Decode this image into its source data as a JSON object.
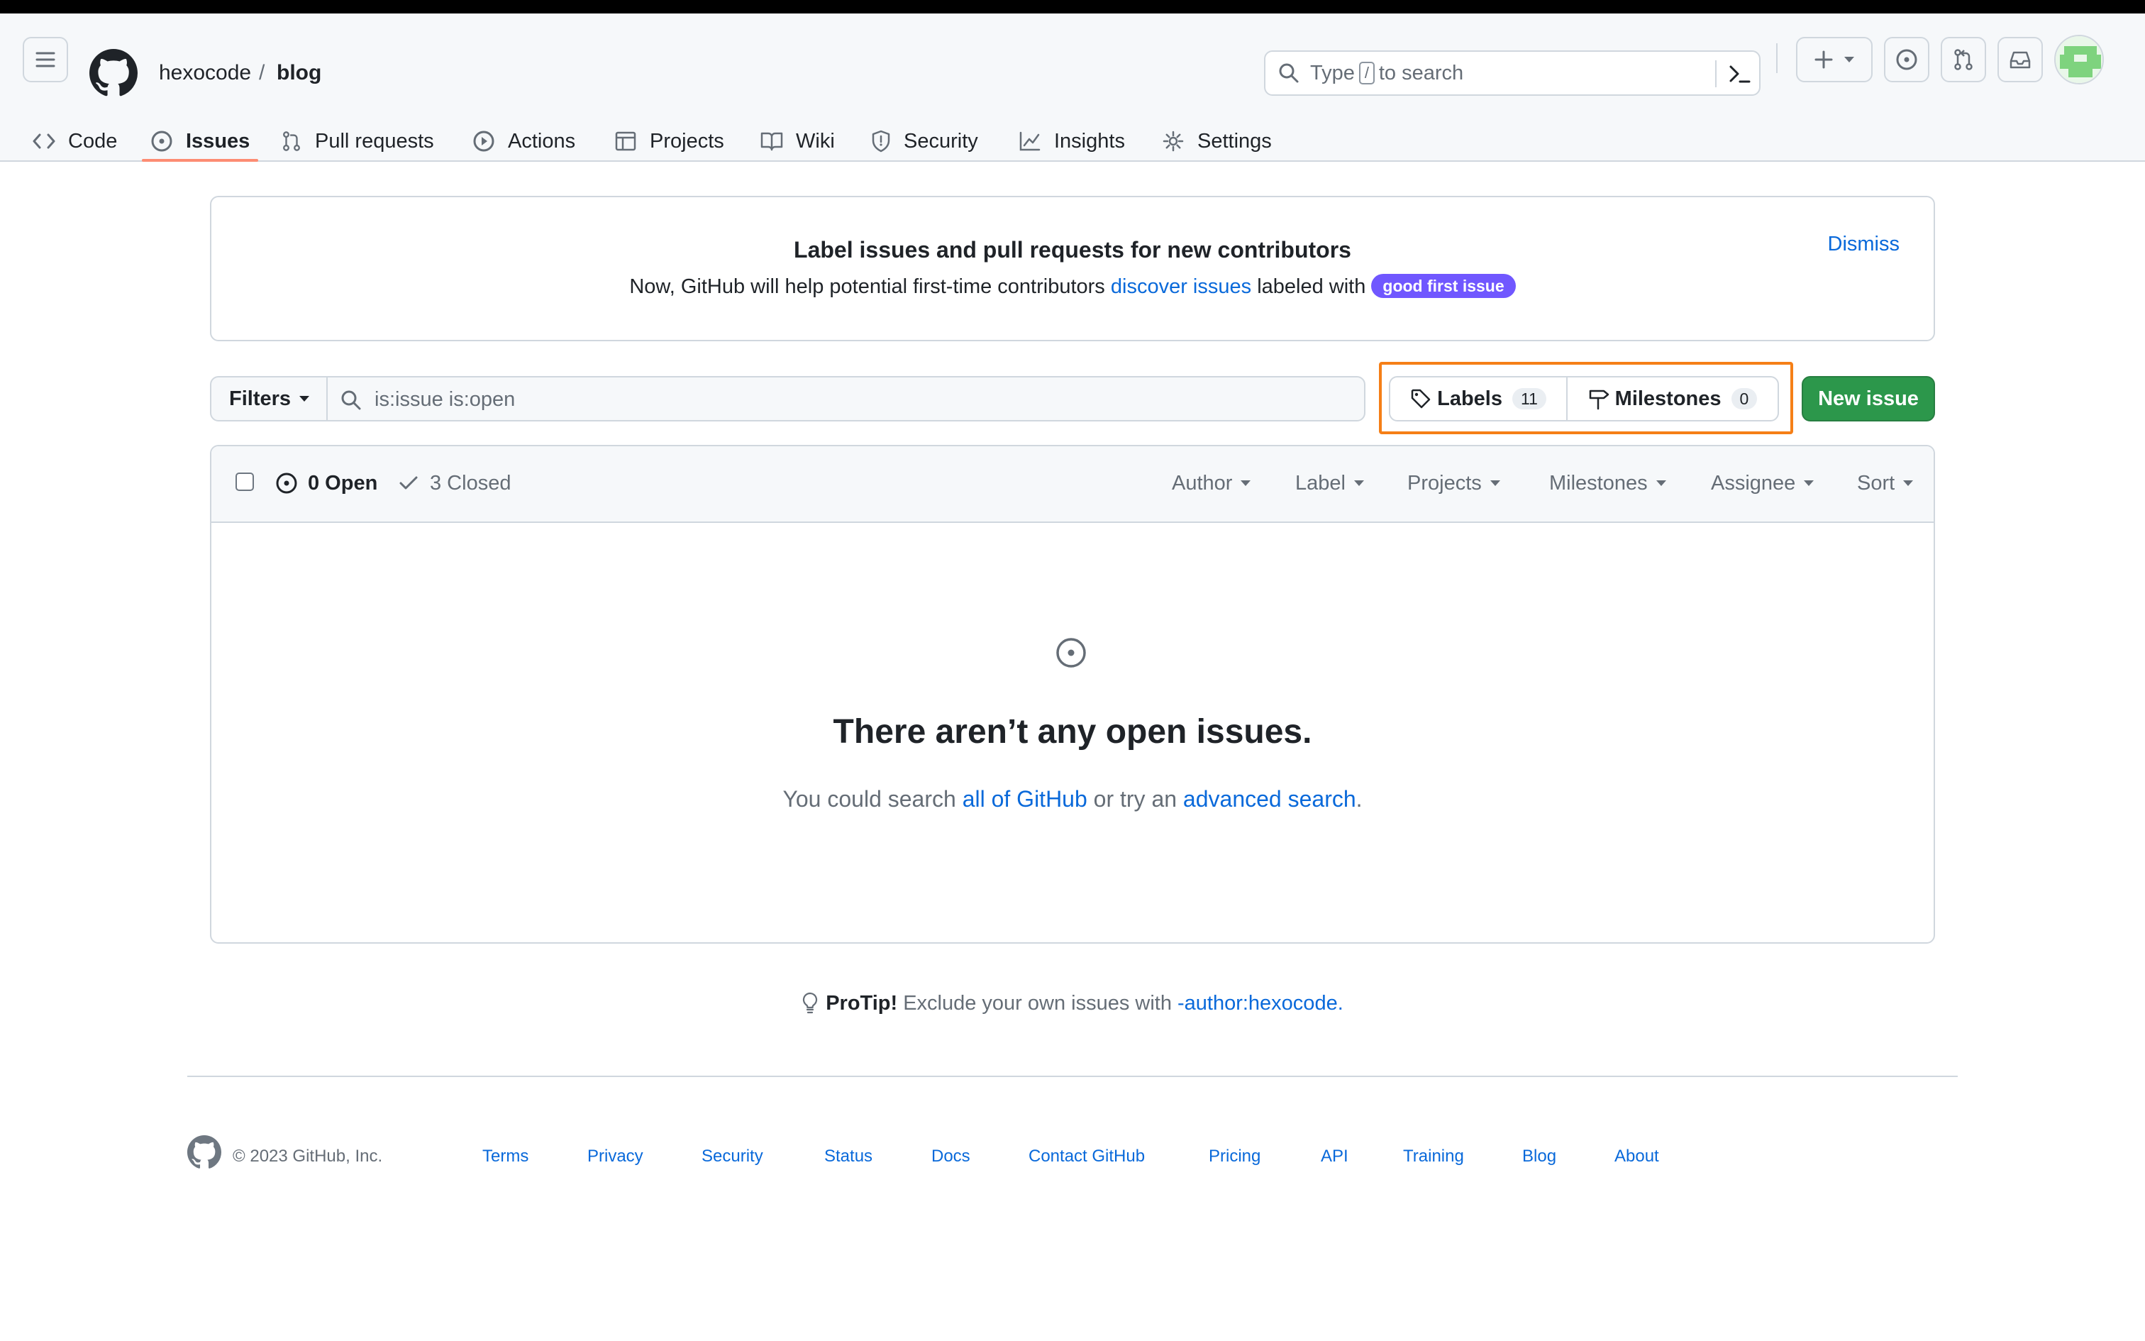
{
  "header": {
    "owner": "hexocode",
    "separator": "/",
    "repo": "blog",
    "search": {
      "prefix": "Type",
      "key": "/",
      "suffix": "to search"
    }
  },
  "tabs": [
    {
      "label": "Code",
      "icon": "code-icon"
    },
    {
      "label": "Issues",
      "icon": "issue-opened-icon",
      "selected": true
    },
    {
      "label": "Pull requests",
      "icon": "git-pull-request-icon"
    },
    {
      "label": "Actions",
      "icon": "play-icon"
    },
    {
      "label": "Projects",
      "icon": "table-icon"
    },
    {
      "label": "Wiki",
      "icon": "book-icon"
    },
    {
      "label": "Security",
      "icon": "shield-icon"
    },
    {
      "label": "Insights",
      "icon": "graph-icon"
    },
    {
      "label": "Settings",
      "icon": "gear-icon"
    }
  ],
  "banner": {
    "title": "Label issues and pull requests for new contributors",
    "text_before": "Now, GitHub will help potential first-time contributors",
    "link": "discover issues",
    "text_after": "labeled with",
    "label": "good first issue",
    "dismiss": "Dismiss"
  },
  "filterbar": {
    "filters_label": "Filters",
    "query": "is:issue is:open",
    "labels": {
      "label": "Labels",
      "count": "11"
    },
    "milestones": {
      "label": "Milestones",
      "count": "0"
    },
    "new_issue": "New issue"
  },
  "list": {
    "open": "0 Open",
    "closed": "3 Closed",
    "filters": [
      "Author",
      "Label",
      "Projects",
      "Milestones",
      "Assignee",
      "Sort"
    ]
  },
  "empty": {
    "title": "There aren’t any open issues.",
    "text1": "You could search",
    "link1": "all of GitHub",
    "text2": "or try an",
    "link2": "advanced search",
    "text3": "."
  },
  "protip": {
    "label": "ProTip!",
    "text": "Exclude your own issues with",
    "link": "-author:hexocode."
  },
  "footer": {
    "copyright": "© 2023 GitHub, Inc.",
    "links": [
      "Terms",
      "Privacy",
      "Security",
      "Status",
      "Docs",
      "Contact GitHub",
      "Pricing",
      "API",
      "Training",
      "Blog",
      "About"
    ]
  },
  "colors": {
    "accent_link": "#0969da",
    "primary_button": "#2c974b",
    "good_first_issue": "#7057ff",
    "highlight": "#f57f17",
    "selected_tab_underline": "#fd8c73"
  }
}
